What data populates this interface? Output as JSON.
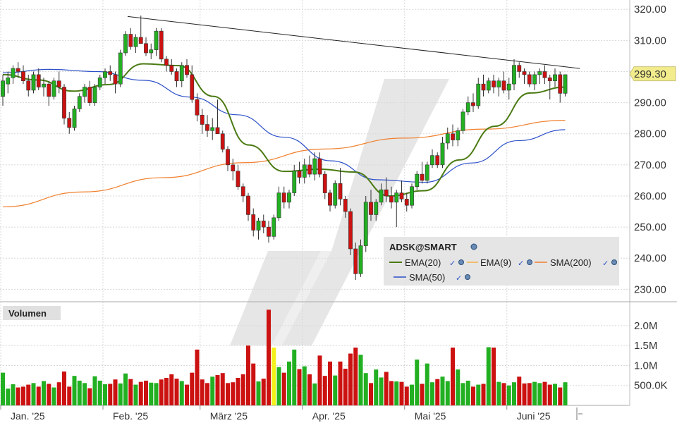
{
  "chart_data": {
    "type": "candlestick",
    "symbol_label": "ADSK@SMART",
    "last_price_label": "299.30",
    "last_price": 299.3,
    "price_axis": {
      "ticks": [
        "230.00",
        "240.00",
        "250.00",
        "260.00",
        "270.00",
        "280.00",
        "290.00",
        "300.00",
        "310.00",
        "320.00"
      ],
      "ylim": [
        226,
        323
      ]
    },
    "volume_panel_title": "Volumen",
    "volume_axis": {
      "ticks": [
        "500.0K",
        "1.0M",
        "1.5M",
        "2.0M"
      ],
      "ylim": [
        0,
        2600000
      ]
    },
    "x_labels": [
      "Jan. '25",
      "Feb. '25",
      "März '25",
      "Apr. '25",
      "Mai '25",
      "Juni '25"
    ],
    "legend": [
      {
        "name": "EMA(20)",
        "color": "#4a7a12"
      },
      {
        "name": "EMA(9)",
        "color": "#f5b041"
      },
      {
        "name": "SMA(200)",
        "color": "#f07f2c"
      },
      {
        "name": "SMA(50)",
        "color": "#2b4fc7"
      }
    ],
    "colors": {
      "up": "#22b022",
      "down": "#cc1111",
      "trendline": "#222222",
      "watermark": "#e4e4e4",
      "price_tag": "#f2ec8c"
    },
    "trendline": {
      "start": 317.7,
      "end": 301.0
    },
    "candles": [
      {
        "o": 292,
        "h": 299,
        "l": 289,
        "c": 297
      },
      {
        "o": 296,
        "h": 300,
        "l": 293,
        "c": 298
      },
      {
        "o": 298,
        "h": 302,
        "l": 296,
        "c": 301
      },
      {
        "o": 301,
        "h": 303,
        "l": 298,
        "c": 300
      },
      {
        "o": 300,
        "h": 302,
        "l": 296,
        "c": 297
      },
      {
        "o": 297,
        "h": 299,
        "l": 292,
        "c": 294
      },
      {
        "o": 294,
        "h": 300,
        "l": 293,
        "c": 299
      },
      {
        "o": 299,
        "h": 301,
        "l": 294,
        "c": 295
      },
      {
        "o": 295,
        "h": 298,
        "l": 292,
        "c": 296
      },
      {
        "o": 296,
        "h": 297,
        "l": 289,
        "c": 292
      },
      {
        "o": 292,
        "h": 298,
        "l": 291,
        "c": 297
      },
      {
        "o": 297,
        "h": 300,
        "l": 293,
        "c": 295
      },
      {
        "o": 295,
        "h": 296,
        "l": 283,
        "c": 285
      },
      {
        "o": 285,
        "h": 287,
        "l": 280,
        "c": 282
      },
      {
        "o": 282,
        "h": 289,
        "l": 281,
        "c": 288
      },
      {
        "o": 288,
        "h": 293,
        "l": 287,
        "c": 292
      },
      {
        "o": 292,
        "h": 296,
        "l": 290,
        "c": 295
      },
      {
        "o": 295,
        "h": 297,
        "l": 289,
        "c": 290
      },
      {
        "o": 290,
        "h": 296,
        "l": 289,
        "c": 295
      },
      {
        "o": 295,
        "h": 299,
        "l": 294,
        "c": 298
      },
      {
        "o": 298,
        "h": 301,
        "l": 296,
        "c": 300
      },
      {
        "o": 300,
        "h": 302,
        "l": 297,
        "c": 299
      },
      {
        "o": 299,
        "h": 300,
        "l": 293,
        "c": 296
      },
      {
        "o": 296,
        "h": 307,
        "l": 295,
        "c": 306
      },
      {
        "o": 306,
        "h": 313,
        "l": 305,
        "c": 312
      },
      {
        "o": 312,
        "h": 314,
        "l": 307,
        "c": 308
      },
      {
        "o": 308,
        "h": 312,
        "l": 306,
        "c": 311
      },
      {
        "o": 311,
        "h": 318,
        "l": 310,
        "c": 309
      },
      {
        "o": 309,
        "h": 311,
        "l": 305,
        "c": 306
      },
      {
        "o": 306,
        "h": 309,
        "l": 304,
        "c": 307
      },
      {
        "o": 307,
        "h": 314,
        "l": 305,
        "c": 313
      },
      {
        "o": 313,
        "h": 314,
        "l": 303,
        "c": 304
      },
      {
        "o": 304,
        "h": 305,
        "l": 300,
        "c": 302
      },
      {
        "o": 302,
        "h": 304,
        "l": 299,
        "c": 300
      },
      {
        "o": 300,
        "h": 301,
        "l": 295,
        "c": 297
      },
      {
        "o": 297,
        "h": 303,
        "l": 295,
        "c": 302
      },
      {
        "o": 302,
        "h": 304,
        "l": 298,
        "c": 299
      },
      {
        "o": 299,
        "h": 302,
        "l": 290,
        "c": 291
      },
      {
        "o": 291,
        "h": 293,
        "l": 284,
        "c": 286
      },
      {
        "o": 286,
        "h": 288,
        "l": 280,
        "c": 283
      },
      {
        "o": 283,
        "h": 286,
        "l": 279,
        "c": 281
      },
      {
        "o": 281,
        "h": 285,
        "l": 278,
        "c": 282
      },
      {
        "o": 282,
        "h": 291,
        "l": 280,
        "c": 280
      },
      {
        "o": 280,
        "h": 281,
        "l": 274,
        "c": 275
      },
      {
        "o": 275,
        "h": 276,
        "l": 268,
        "c": 270
      },
      {
        "o": 270,
        "h": 272,
        "l": 265,
        "c": 268
      },
      {
        "o": 268,
        "h": 270,
        "l": 262,
        "c": 263
      },
      {
        "o": 263,
        "h": 264,
        "l": 258,
        "c": 260
      },
      {
        "o": 260,
        "h": 261,
        "l": 252,
        "c": 254
      },
      {
        "o": 254,
        "h": 256,
        "l": 247,
        "c": 249
      },
      {
        "o": 249,
        "h": 253,
        "l": 246,
        "c": 252
      },
      {
        "o": 252,
        "h": 254,
        "l": 248,
        "c": 250
      },
      {
        "o": 250,
        "h": 252,
        "l": 245,
        "c": 247
      },
      {
        "o": 247,
        "h": 254,
        "l": 246,
        "c": 253
      },
      {
        "o": 253,
        "h": 263,
        "l": 252,
        "c": 261
      },
      {
        "o": 261,
        "h": 263,
        "l": 256,
        "c": 258
      },
      {
        "o": 258,
        "h": 262,
        "l": 256,
        "c": 261
      },
      {
        "o": 261,
        "h": 270,
        "l": 260,
        "c": 268
      },
      {
        "o": 268,
        "h": 271,
        "l": 264,
        "c": 266
      },
      {
        "o": 266,
        "h": 272,
        "l": 264,
        "c": 270
      },
      {
        "o": 270,
        "h": 273,
        "l": 266,
        "c": 267
      },
      {
        "o": 267,
        "h": 274,
        "l": 265,
        "c": 272
      },
      {
        "o": 272,
        "h": 274,
        "l": 266,
        "c": 267
      },
      {
        "o": 267,
        "h": 268,
        "l": 259,
        "c": 261
      },
      {
        "o": 261,
        "h": 262,
        "l": 255,
        "c": 257
      },
      {
        "o": 257,
        "h": 265,
        "l": 256,
        "c": 264
      },
      {
        "o": 264,
        "h": 269,
        "l": 257,
        "c": 259
      },
      {
        "o": 259,
        "h": 260,
        "l": 253,
        "c": 255
      },
      {
        "o": 255,
        "h": 256,
        "l": 241,
        "c": 243
      },
      {
        "o": 243,
        "h": 245,
        "l": 233,
        "c": 235
      },
      {
        "o": 235,
        "h": 246,
        "l": 234,
        "c": 244
      },
      {
        "o": 244,
        "h": 260,
        "l": 242,
        "c": 258
      },
      {
        "o": 258,
        "h": 262,
        "l": 252,
        "c": 254
      },
      {
        "o": 254,
        "h": 259,
        "l": 252,
        "c": 258
      },
      {
        "o": 258,
        "h": 264,
        "l": 257,
        "c": 262
      },
      {
        "o": 262,
        "h": 266,
        "l": 258,
        "c": 260
      },
      {
        "o": 260,
        "h": 263,
        "l": 256,
        "c": 258
      },
      {
        "o": 258,
        "h": 262,
        "l": 250,
        "c": 261
      },
      {
        "o": 261,
        "h": 265,
        "l": 258,
        "c": 259
      },
      {
        "o": 259,
        "h": 261,
        "l": 255,
        "c": 257
      },
      {
        "o": 257,
        "h": 264,
        "l": 256,
        "c": 263
      },
      {
        "o": 263,
        "h": 268,
        "l": 262,
        "c": 267
      },
      {
        "o": 267,
        "h": 271,
        "l": 264,
        "c": 265
      },
      {
        "o": 265,
        "h": 271,
        "l": 264,
        "c": 270
      },
      {
        "o": 270,
        "h": 275,
        "l": 269,
        "c": 273
      },
      {
        "o": 273,
        "h": 274,
        "l": 269,
        "c": 270
      },
      {
        "o": 270,
        "h": 279,
        "l": 269,
        "c": 277
      },
      {
        "o": 277,
        "h": 282,
        "l": 275,
        "c": 280
      },
      {
        "o": 280,
        "h": 283,
        "l": 276,
        "c": 278
      },
      {
        "o": 278,
        "h": 282,
        "l": 276,
        "c": 281
      },
      {
        "o": 281,
        "h": 288,
        "l": 280,
        "c": 287
      },
      {
        "o": 287,
        "h": 292,
        "l": 286,
        "c": 290
      },
      {
        "o": 290,
        "h": 293,
        "l": 287,
        "c": 289
      },
      {
        "o": 289,
        "h": 298,
        "l": 288,
        "c": 296
      },
      {
        "o": 296,
        "h": 299,
        "l": 292,
        "c": 294
      },
      {
        "o": 294,
        "h": 298,
        "l": 293,
        "c": 297
      },
      {
        "o": 297,
        "h": 299,
        "l": 293,
        "c": 295
      },
      {
        "o": 295,
        "h": 298,
        "l": 292,
        "c": 297
      },
      {
        "o": 297,
        "h": 300,
        "l": 293,
        "c": 294
      },
      {
        "o": 294,
        "h": 298,
        "l": 291,
        "c": 296
      },
      {
        "o": 296,
        "h": 304,
        "l": 294,
        "c": 302
      },
      {
        "o": 302,
        "h": 303,
        "l": 298,
        "c": 300
      },
      {
        "o": 300,
        "h": 301,
        "l": 296,
        "c": 299
      },
      {
        "o": 299,
        "h": 300,
        "l": 295,
        "c": 296
      },
      {
        "o": 296,
        "h": 300,
        "l": 294,
        "c": 299
      },
      {
        "o": 299,
        "h": 301,
        "l": 296,
        "c": 300
      },
      {
        "o": 300,
        "h": 302,
        "l": 296,
        "c": 298
      },
      {
        "o": 298,
        "h": 299,
        "l": 291,
        "c": 297
      },
      {
        "o": 297,
        "h": 301,
        "l": 295,
        "c": 299
      },
      {
        "o": 299,
        "h": 300,
        "l": 290,
        "c": 293
      },
      {
        "o": 293,
        "h": 296,
        "l": 292,
        "c": 299
      }
    ],
    "volume": [
      820000,
      420000,
      530000,
      450000,
      470000,
      520000,
      560000,
      470000,
      610000,
      540000,
      450000,
      580000,
      850000,
      470000,
      740000,
      620000,
      560000,
      430000,
      730000,
      620000,
      530000,
      540000,
      650000,
      550000,
      800000,
      660000,
      520000,
      590000,
      620000,
      570000,
      560000,
      650000,
      690000,
      780000,
      670000,
      610000,
      520000,
      820000,
      1400000,
      650000,
      560000,
      720000,
      760000,
      810000,
      560000,
      580000,
      690000,
      780000,
      1500000,
      1050000,
      600000,
      670000,
      2400000,
      1450000,
      960000,
      820000,
      1100000,
      1400000,
      910000,
      980000,
      780000,
      550000,
      1250000,
      740000,
      1100000,
      750000,
      1100000,
      920000,
      1300000,
      1450000,
      1270000,
      810000,
      560000,
      900000,
      700000,
      840000,
      610000,
      600000,
      590000,
      470000,
      520000,
      1150000,
      540000,
      1050000,
      580000,
      660000,
      720000,
      610000,
      1450000,
      900000,
      560000,
      620000,
      470000,
      520000,
      540000,
      1460000,
      1450000,
      590000,
      560000,
      500000,
      580000,
      720000,
      550000,
      560000,
      590000,
      560000,
      590000,
      520000,
      540000,
      450000,
      580000
    ],
    "sma200": [
      256.5,
      261.3,
      265.9,
      270.7,
      275.1,
      278.6,
      281.5,
      284.3
    ],
    "sma50": [
      299.6,
      300.7,
      300.0,
      297.2,
      291.8,
      286.1,
      278.9,
      271.3,
      265.2,
      264.4,
      270.6,
      277.8,
      281.3
    ],
    "ema20": [
      299.0,
      297.3,
      293.7,
      295.8,
      302.5,
      301.9,
      292.0,
      276.4,
      267.9,
      268.6,
      267.7,
      260.0,
      261.7,
      271.6,
      282.4,
      293.1,
      295.0
    ]
  }
}
